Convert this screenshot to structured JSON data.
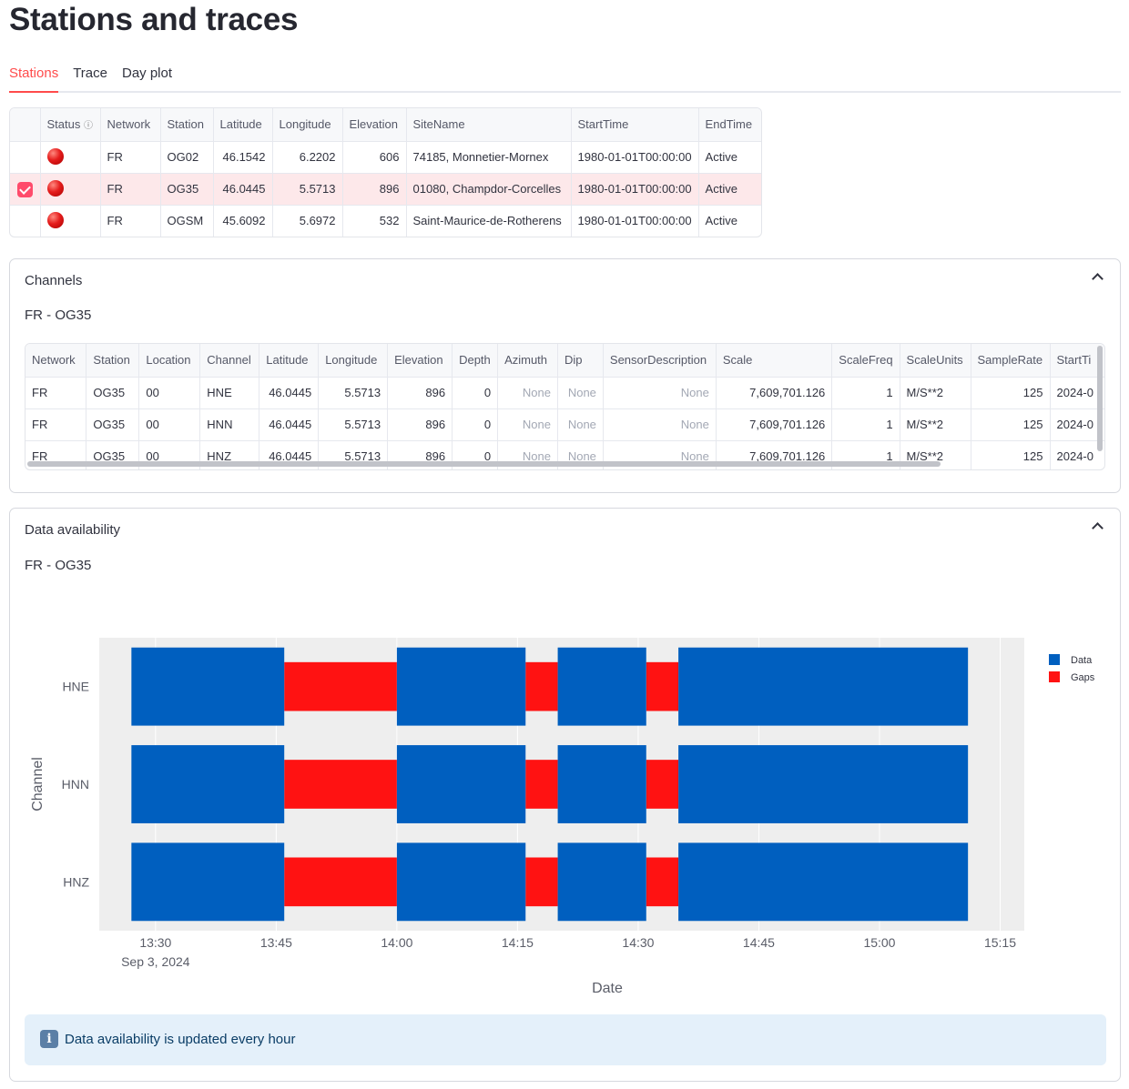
{
  "page": {
    "title": "Stations and traces"
  },
  "tabs": [
    {
      "label": "Stations",
      "active": true
    },
    {
      "label": "Trace",
      "active": false
    },
    {
      "label": "Day plot",
      "active": false
    }
  ],
  "stations": {
    "columns": [
      "Status",
      "Network",
      "Station",
      "Latitude",
      "Longitude",
      "Elevation",
      "SiteName",
      "StartTime",
      "EndTime"
    ],
    "status_info_icon": "ⓘ",
    "rows": [
      {
        "selected": false,
        "status": "red-dot",
        "network": "FR",
        "station": "OG02",
        "latitude": "46.1542",
        "longitude": "6.2202",
        "elevation": "606",
        "sitename": "74185, Monnetier-Mornex",
        "starttime": "1980-01-01T00:00:00",
        "endtime": "Active"
      },
      {
        "selected": true,
        "status": "red-dot",
        "network": "FR",
        "station": "OG35",
        "latitude": "46.0445",
        "longitude": "5.5713",
        "elevation": "896",
        "sitename": "01080, Champdor-Corcelles",
        "starttime": "1980-01-01T00:00:00",
        "endtime": "Active"
      },
      {
        "selected": false,
        "status": "red-dot",
        "network": "FR",
        "station": "OGSM",
        "latitude": "45.6092",
        "longitude": "5.6972",
        "elevation": "532",
        "sitename": "Saint-Maurice-de-Rotherens",
        "starttime": "1980-01-01T00:00:00",
        "endtime": "Active"
      }
    ]
  },
  "channels_panel": {
    "title": "Channels",
    "subtitle": "FR - OG35",
    "columns": [
      "Network",
      "Station",
      "Location",
      "Channel",
      "Latitude",
      "Longitude",
      "Elevation",
      "Depth",
      "Azimuth",
      "Dip",
      "SensorDescription",
      "Scale",
      "ScaleFreq",
      "ScaleUnits",
      "SampleRate",
      "StartTi"
    ],
    "rows": [
      [
        "FR",
        "OG35",
        "00",
        "HNE",
        "46.0445",
        "5.5713",
        "896",
        "0",
        "None",
        "None",
        "None",
        "7,609,701.126",
        "1",
        "M/S**2",
        "125",
        "2024-0"
      ],
      [
        "FR",
        "OG35",
        "00",
        "HNN",
        "46.0445",
        "5.5713",
        "896",
        "0",
        "None",
        "None",
        "None",
        "7,609,701.126",
        "1",
        "M/S**2",
        "125",
        "2024-0"
      ],
      [
        "FR",
        "OG35",
        "00",
        "HNZ",
        "46.0445",
        "5.5713",
        "896",
        "0",
        "None",
        "None",
        "None",
        "7,609,701.126",
        "1",
        "M/S**2",
        "125",
        "2024-0"
      ]
    ]
  },
  "availability_panel": {
    "title": "Data availability",
    "subtitle": "FR - OG35",
    "info": "Data availability is updated every hour",
    "info_icon": "info-icon"
  },
  "chart_data": {
    "type": "timeline",
    "xlabel": "Date",
    "ylabel": "Channel",
    "xlim": [
      "13:23",
      "15:18"
    ],
    "x_ticks": [
      "13:30",
      "13:45",
      "14:00",
      "14:15",
      "14:30",
      "14:45",
      "15:00",
      "15:15"
    ],
    "x_date_label": "Sep 3, 2024",
    "categories": [
      "HNE",
      "HNN",
      "HNZ"
    ],
    "legend": [
      "Data",
      "Gaps"
    ],
    "legend_position": "top-right",
    "colors": {
      "Data": "#005fbf",
      "Gaps": "#ff1212",
      "plot_bg": "#eeeeee",
      "grid": "#ffffff"
    },
    "series": [
      {
        "name": "Data",
        "intervals": [
          [
            "13:27",
            "13:46"
          ],
          [
            "14:00",
            "14:16"
          ],
          [
            "14:20",
            "14:31"
          ],
          [
            "14:35",
            "15:11"
          ]
        ]
      },
      {
        "name": "Gaps",
        "intervals": [
          [
            "13:46",
            "14:00"
          ],
          [
            "14:16",
            "14:20"
          ],
          [
            "14:31",
            "14:35"
          ]
        ]
      }
    ]
  }
}
